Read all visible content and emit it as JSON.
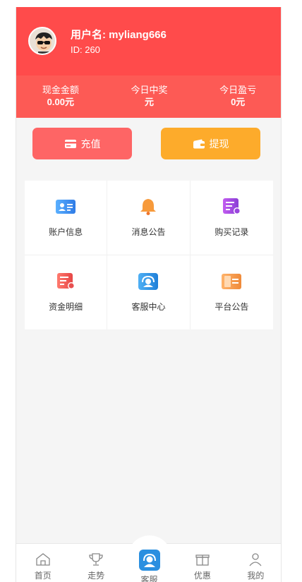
{
  "user": {
    "name": "用户名: myliang666",
    "id": "ID: 260"
  },
  "stats": [
    {
      "label": "现金金额",
      "value": "0.00元"
    },
    {
      "label": "今日中奖",
      "value": "元"
    },
    {
      "label": "今日盈亏",
      "value": "0元"
    }
  ],
  "actions": {
    "recharge": "充值",
    "withdraw": "提现"
  },
  "menu": [
    {
      "label": "账户信息",
      "icon": "account-card-icon",
      "color": "#3b8ff0"
    },
    {
      "label": "消息公告",
      "icon": "bell-icon",
      "color": "#f79a3b"
    },
    {
      "label": "购买记录",
      "icon": "purchase-record-icon",
      "color": "#a24de0"
    },
    {
      "label": "资金明细",
      "icon": "funds-detail-icon",
      "color": "#ee5a5a"
    },
    {
      "label": "客服中心",
      "icon": "customer-service-icon",
      "color": "#2a8fe0"
    },
    {
      "label": "平台公告",
      "icon": "platform-notice-icon",
      "color": "#f3a25a"
    }
  ],
  "tabs": [
    {
      "label": "首页",
      "icon": "home-icon"
    },
    {
      "label": "走势",
      "icon": "trophy-icon"
    },
    {
      "label": "客服",
      "icon": "customer-service-icon"
    },
    {
      "label": "优惠",
      "icon": "gift-icon"
    },
    {
      "label": "我的",
      "icon": "user-icon"
    }
  ],
  "colors": {
    "header": "#ff4b4b",
    "stats_bar": "#fd5a55",
    "recharge": "#fe6565",
    "withdraw": "#fdab2b"
  }
}
